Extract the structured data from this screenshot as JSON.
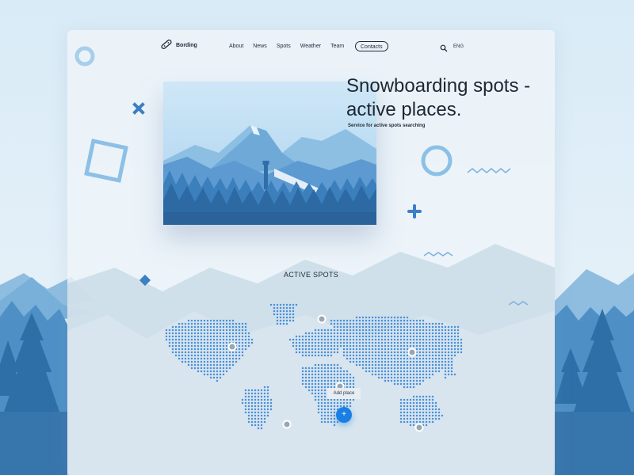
{
  "brand": {
    "name": "Bording",
    "logo_icon": "snowboard-icon"
  },
  "nav": {
    "links": [
      "About",
      "News",
      "Spots",
      "Weather",
      "Team"
    ],
    "contacts_label": "Contacts",
    "language": "ENG"
  },
  "hero": {
    "title_line1": "Snowboarding spots -",
    "title_line2": "active places.",
    "subtitle": "Service for active spots searching"
  },
  "spots": {
    "title": "ACTIVE SPOTS",
    "add_place_label": "Add place",
    "add_button_symbol": "+"
  },
  "colors": {
    "accent": "#1a7fe3",
    "deco_blue": "#3b7fc4",
    "map_dot": "#4a90d9"
  }
}
